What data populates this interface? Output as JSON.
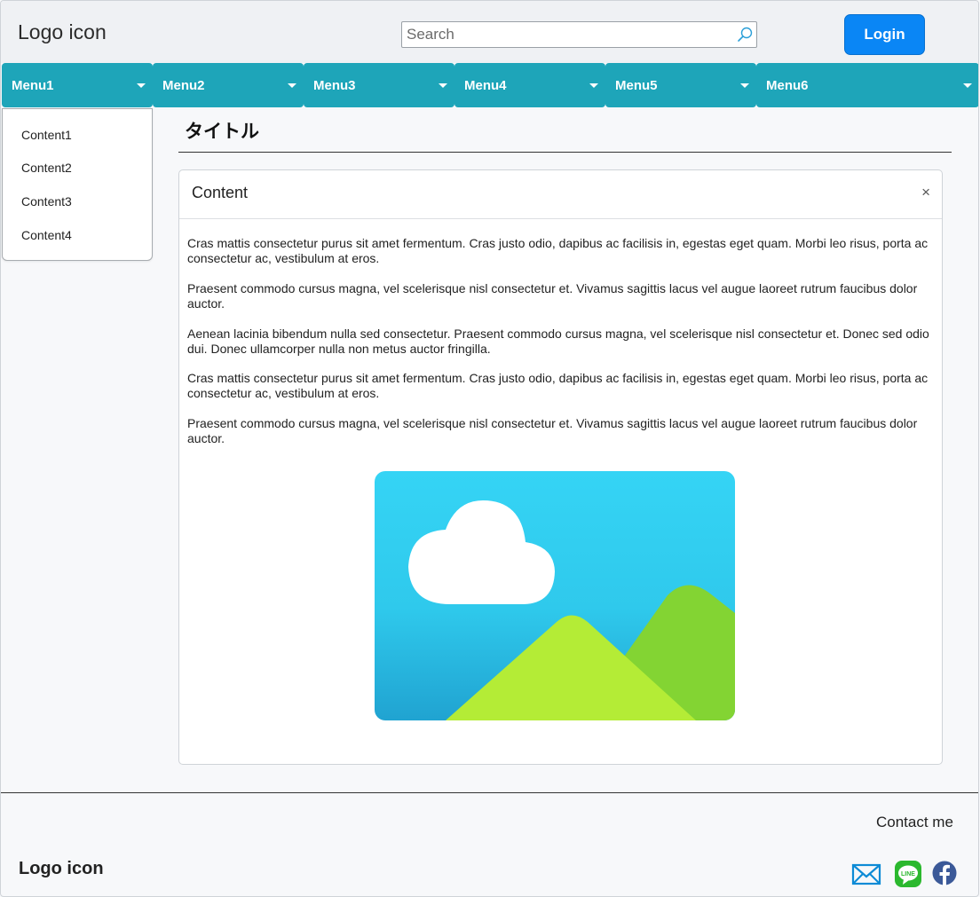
{
  "header": {
    "logo": "Logo icon",
    "search_placeholder": "Search",
    "login_label": "Login"
  },
  "nav": {
    "items": [
      {
        "label": "Menu1"
      },
      {
        "label": "Menu2"
      },
      {
        "label": "Menu3"
      },
      {
        "label": "Menu4"
      },
      {
        "label": "Menu5"
      },
      {
        "label": "Menu6"
      }
    ]
  },
  "dropdown": {
    "items": [
      "Content1",
      "Content2",
      "Content3",
      "Content4"
    ]
  },
  "main": {
    "title": "タイトル",
    "card": {
      "title": "Content",
      "close": "×",
      "paragraphs": [
        "Cras mattis consectetur purus sit amet fermentum. Cras justo odio, dapibus ac facilisis in, egestas eget quam. Morbi leo risus, porta ac consectetur ac, vestibulum at eros.",
        "Praesent commodo cursus magna, vel scelerisque nisl consectetur et. Vivamus sagittis lacus vel augue laoreet rutrum faucibus dolor auctor.",
        "Aenean lacinia bibendum nulla sed consectetur. Praesent commodo cursus magna, vel scelerisque nisl consectetur et. Donec sed odio dui. Donec ullamcorper nulla non metus auctor fringilla.",
        "Cras mattis consectetur purus sit amet fermentum. Cras justo odio, dapibus ac facilisis in, egestas eget quam. Morbi leo risus, porta ac consectetur ac, vestibulum at eros.",
        "Praesent commodo cursus magna, vel scelerisque nisl consectetur et. Vivamus sagittis lacus vel augue laoreet rutrum faucibus dolor auctor."
      ],
      "image_icon": "image-placeholder-icon"
    }
  },
  "footer": {
    "contact": "Contact me",
    "logo": "Logo icon",
    "social_icons": [
      "mail-icon",
      "line-icon",
      "facebook-icon"
    ]
  },
  "colors": {
    "nav": "#1ea5b9",
    "login": "#0a86f5",
    "facebook": "#3b5998",
    "line": "#2bb82e",
    "mail": "#0d8bd6"
  }
}
